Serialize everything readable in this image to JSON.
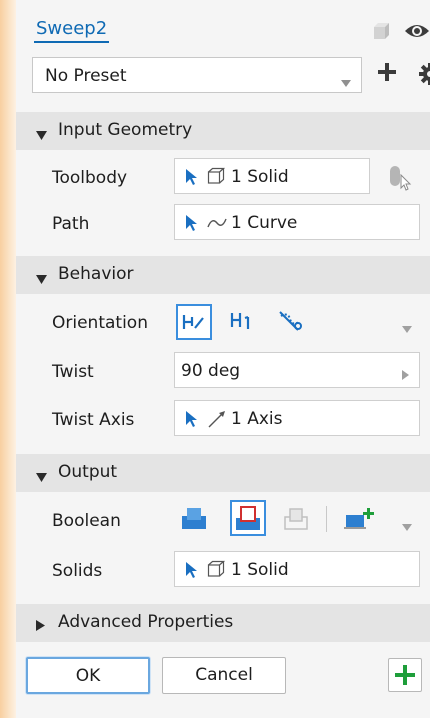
{
  "title": "Sweep2",
  "preset": {
    "value": "No Preset"
  },
  "sections": {
    "input": "Input Geometry",
    "behavior": "Behavior",
    "output": "Output",
    "advanced": "Advanced Properties"
  },
  "input_geometry": {
    "toolbody_label": "Toolbody",
    "toolbody_value": "1 Solid",
    "path_label": "Path",
    "path_value": "1 Curve"
  },
  "behavior": {
    "orientation_label": "Orientation",
    "twist_label": "Twist",
    "twist_value": "90 deg",
    "twist_axis_label": "Twist Axis",
    "twist_axis_value": "1 Axis"
  },
  "output": {
    "boolean_label": "Boolean",
    "solids_label": "Solids",
    "solids_value": "1 Solid"
  },
  "footer": {
    "ok": "OK",
    "cancel": "Cancel"
  },
  "icons": [
    "cube-icon",
    "eye-icon",
    "plus-icon",
    "gear-icon",
    "cursor-arrow-icon",
    "solid-box-icon",
    "curve-icon",
    "axis-icon",
    "add-icon"
  ],
  "colors": {
    "accent": "#0f6ab4",
    "selection": "#3a8ede",
    "add_green": "#1e9e3a",
    "highlight_red": "#d03030"
  }
}
